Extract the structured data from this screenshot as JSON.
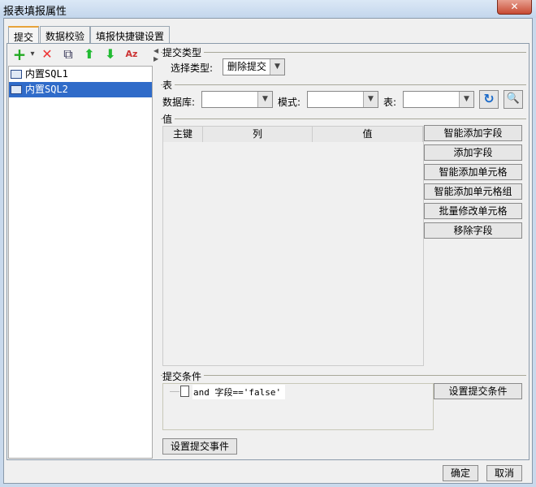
{
  "window": {
    "title": "报表填报属性",
    "close": "✕"
  },
  "tabs": [
    "提交",
    "数据校验",
    "填报快捷键设置"
  ],
  "toolbar": {
    "add": "+",
    "dropdown": "▾",
    "delete": "✕",
    "copy": "⧉",
    "up": "⬆",
    "down": "⬇",
    "sort": "Az"
  },
  "list": [
    "内置SQL1",
    "内置SQL2"
  ],
  "submit_type": {
    "section": "提交类型",
    "label": "选择类型:",
    "value": "删除提交"
  },
  "table": {
    "section": "表",
    "db_label": "数据库:",
    "db_value": "",
    "schema_label": "模式:",
    "schema_value": "",
    "table_label": "表:",
    "table_value": ""
  },
  "values": {
    "section": "值",
    "columns": [
      "主键",
      "列",
      "值"
    ],
    "buttons": [
      "智能添加字段",
      "添加字段",
      "智能添加单元格",
      "智能添加单元格组",
      "批量修改单元格",
      "移除字段"
    ]
  },
  "condition": {
    "section": "提交条件",
    "item": "and 字段=='false'",
    "button": "设置提交条件"
  },
  "event_button": "设置提交事件",
  "footer": {
    "ok": "确定",
    "cancel": "取消"
  }
}
